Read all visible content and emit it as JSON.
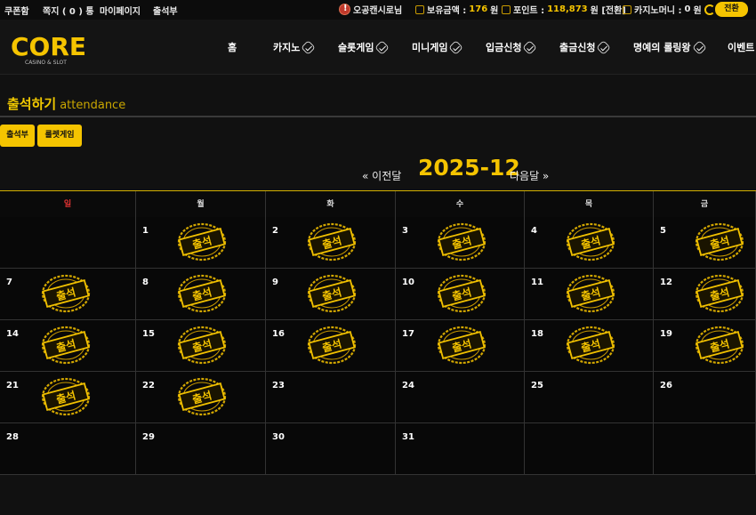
{
  "topbar": {
    "left_links": [
      "쿠폰함",
      "쪽지 ( 0 ) 통",
      "마이페이지",
      "출석부"
    ],
    "user": "오공캔시로님",
    "balance_label": "보유금액 :",
    "balance_value": "176",
    "balance_unit": "원",
    "point_label": "포인트 :",
    "point_value": "118,873",
    "point_unit": "원 [전환]",
    "casino_label": "카지노머니 :",
    "casino_value": "0",
    "casino_unit": "원",
    "exchange_button": "전환"
  },
  "logo": {
    "main": "CORE",
    "sub": "CASINO & SLOT"
  },
  "nav": [
    "홈",
    "카지노",
    "슬롯게임",
    "미니게임",
    "입금신청",
    "출금신청",
    "명예의 롤링왕",
    "이벤트"
  ],
  "page": {
    "title": "출석하기",
    "subtitle": "attendance",
    "tab_attendance": "출석부",
    "tab_roulette": "룰렛게임",
    "prev_label": "« 이전달",
    "month_label": "2025-12",
    "next_label": "다음달 »"
  },
  "calendar": {
    "weekdays": [
      "일",
      "월",
      "화",
      "수",
      "목",
      "금"
    ],
    "stamp_text": "출석",
    "weeks": [
      [
        null,
        1,
        2,
        3,
        4,
        5
      ],
      [
        7,
        8,
        9,
        10,
        11,
        12
      ],
      [
        14,
        15,
        16,
        17,
        18,
        19
      ],
      [
        21,
        22,
        23,
        24,
        25,
        26
      ],
      [
        28,
        29,
        30,
        31,
        null,
        null
      ]
    ],
    "attended_days": [
      1,
      2,
      3,
      4,
      5,
      7,
      8,
      9,
      10,
      11,
      12,
      14,
      15,
      16,
      17,
      18,
      19,
      21,
      22
    ]
  },
  "colors": {
    "accent": "#f5c400",
    "sunday": "#e53333"
  }
}
